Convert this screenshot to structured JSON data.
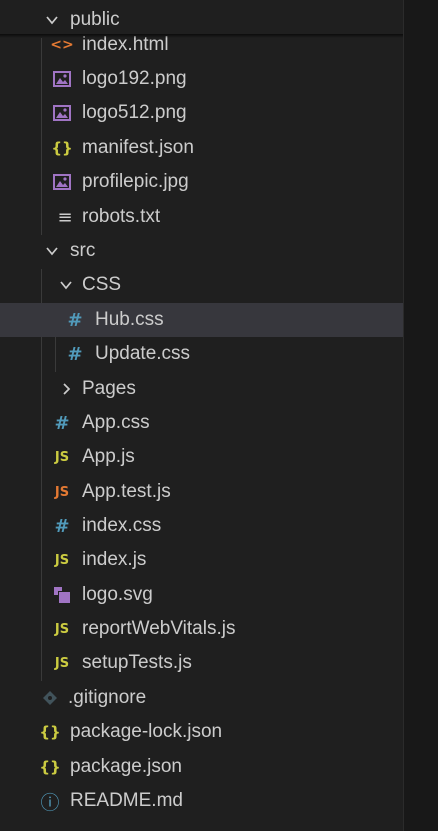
{
  "explorer": {
    "items": [
      {
        "label": "public",
        "kind": "folder",
        "expanded": true,
        "icon": "chevron-down-icon"
      },
      {
        "label": "index.html",
        "kind": "file",
        "icon": "html-icon",
        "icon_glyph": "<>",
        "icon_color": "#e37933"
      },
      {
        "label": "logo192.png",
        "kind": "file",
        "icon": "image-icon",
        "icon_color": "#a074c4"
      },
      {
        "label": "logo512.png",
        "kind": "file",
        "icon": "image-icon",
        "icon_color": "#a074c4"
      },
      {
        "label": "manifest.json",
        "kind": "file",
        "icon": "json-icon",
        "icon_glyph": "{}",
        "icon_color": "#cbcb41"
      },
      {
        "label": "profilepic.jpg",
        "kind": "file",
        "icon": "image-icon",
        "icon_color": "#a074c4"
      },
      {
        "label": "robots.txt",
        "kind": "file",
        "icon": "text-lines-icon",
        "icon_glyph": "≡",
        "icon_color": "#cccccc"
      },
      {
        "label": "src",
        "kind": "folder",
        "expanded": true,
        "icon": "chevron-down-icon"
      },
      {
        "label": "CSS",
        "kind": "folder",
        "expanded": true,
        "icon": "chevron-down-icon"
      },
      {
        "label": "Hub.css",
        "kind": "file",
        "icon": "css-hash-icon",
        "icon_glyph": "#",
        "icon_color": "#519aba",
        "selected": true
      },
      {
        "label": "Update.css",
        "kind": "file",
        "icon": "css-hash-icon",
        "icon_glyph": "#",
        "icon_color": "#519aba"
      },
      {
        "label": "Pages",
        "kind": "folder",
        "expanded": false,
        "icon": "chevron-right-icon"
      },
      {
        "label": "App.css",
        "kind": "file",
        "icon": "css-hash-icon",
        "icon_glyph": "#",
        "icon_color": "#519aba"
      },
      {
        "label": "App.js",
        "kind": "file",
        "icon": "javascript-icon",
        "icon_glyph": "JS",
        "icon_color": "#cbcb41"
      },
      {
        "label": "App.test.js",
        "kind": "file",
        "icon": "javascript-test-icon",
        "icon_glyph": "JS",
        "icon_color": "#e37933"
      },
      {
        "label": "index.css",
        "kind": "file",
        "icon": "css-hash-icon",
        "icon_glyph": "#",
        "icon_color": "#519aba"
      },
      {
        "label": "index.js",
        "kind": "file",
        "icon": "javascript-icon",
        "icon_glyph": "JS",
        "icon_color": "#cbcb41"
      },
      {
        "label": "logo.svg",
        "kind": "file",
        "icon": "svg-icon",
        "icon_color": "#a074c4"
      },
      {
        "label": "reportWebVitals.js",
        "kind": "file",
        "icon": "javascript-icon",
        "icon_glyph": "JS",
        "icon_color": "#cbcb41"
      },
      {
        "label": "setupTests.js",
        "kind": "file",
        "icon": "javascript-icon",
        "icon_glyph": "JS",
        "icon_color": "#cbcb41"
      },
      {
        "label": ".gitignore",
        "kind": "file",
        "icon": "git-diamond-icon",
        "icon_color": "#41535b"
      },
      {
        "label": "package-lock.json",
        "kind": "file",
        "icon": "json-icon",
        "icon_glyph": "{}",
        "icon_color": "#cbcb41"
      },
      {
        "label": "package.json",
        "kind": "file",
        "icon": "json-icon",
        "icon_glyph": "{}",
        "icon_color": "#cbcb41"
      },
      {
        "label": "README.md",
        "kind": "file",
        "icon": "info-circle-icon",
        "icon_glyph": "ⓘ",
        "icon_color": "#519aba"
      }
    ]
  },
  "colors": {
    "background": "#1f1f1f",
    "selected_row": "#37373d",
    "text": "#cccccc",
    "indent_guide": "#3a3a3a"
  }
}
